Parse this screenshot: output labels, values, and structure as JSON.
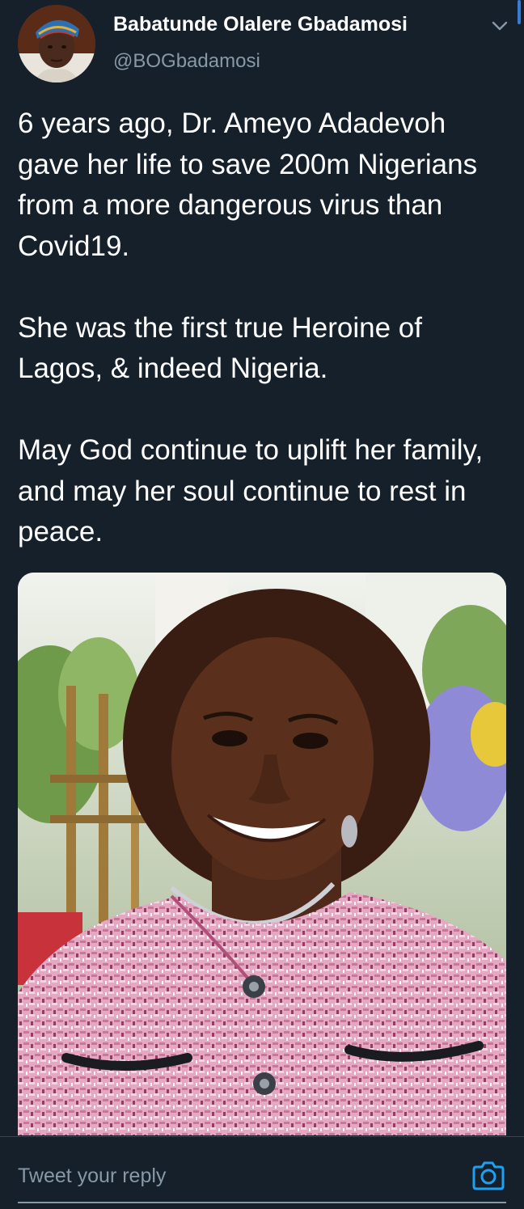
{
  "author": {
    "display_name": "Babatunde Olalere Gbadamosi",
    "handle": "@BOGbadamosi"
  },
  "tweet": {
    "paragraphs": [
      "6 years ago, Dr. Ameyo Adadevoh gave her life to save 200m Nigerians from a more dangerous virus than Covid19.",
      "She was the first true Heroine of Lagos, & indeed Nigeria.",
      "May God continue to uplift her family, and may her soul continue to rest in peace."
    ]
  },
  "reply": {
    "placeholder": "Tweet your reply"
  },
  "icons": {
    "menu": "chevron-down-icon",
    "camera": "camera-icon"
  },
  "colors": {
    "background": "#15202b",
    "text_primary": "#ffffff",
    "text_secondary": "#8899a6",
    "accent": "#1da1f2",
    "divider": "#38444d"
  }
}
